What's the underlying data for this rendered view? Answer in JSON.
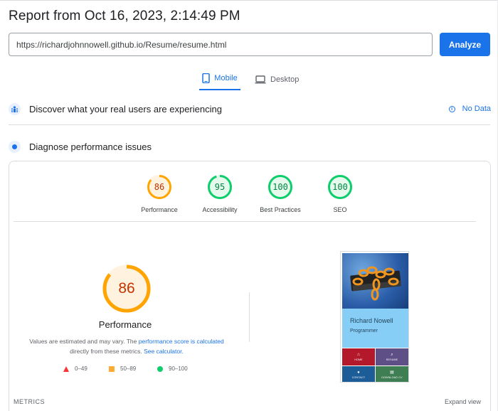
{
  "report": {
    "title": "Report from Oct 16, 2023, 2:14:49 PM"
  },
  "url_bar": {
    "value": "https://richardjohnnowell.github.io/Resume/resume.html",
    "analyze_label": "Analyze"
  },
  "device_tabs": {
    "mobile": "Mobile",
    "desktop": "Desktop",
    "active": "mobile"
  },
  "real_users": {
    "label": "Discover what your real users are experiencing",
    "no_data": "No Data"
  },
  "diagnose": {
    "label": "Diagnose performance issues"
  },
  "scores": [
    {
      "label": "Performance",
      "value": "86",
      "color": "#ffa400",
      "text_color": "#c33300",
      "fraction": 0.86
    },
    {
      "label": "Accessibility",
      "value": "95",
      "color": "#0cce6b",
      "text_color": "#018642",
      "fraction": 0.95
    },
    {
      "label": "Best Practices",
      "value": "100",
      "color": "#0cce6b",
      "text_color": "#018642",
      "fraction": 1.0
    },
    {
      "label": "SEO",
      "value": "100",
      "color": "#0cce6b",
      "text_color": "#018642",
      "fraction": 1.0
    }
  ],
  "performance": {
    "score": "86",
    "fraction": 0.86,
    "title": "Performance",
    "note_prefix": "Values are estimated and may vary. The ",
    "note_link": "performance score is calculated",
    "note_middle": " directly from these metrics. ",
    "note_link2": "See calculator."
  },
  "legend": {
    "low": "0–49",
    "mid": "50–89",
    "high": "90–100"
  },
  "screenshot": {
    "name": "Richard Nowell",
    "role": "Programmer",
    "tiles": {
      "home": "HOME",
      "resume": "RESUME",
      "contact": "CONTACT",
      "download": "DOWNLOAD CV"
    }
  },
  "footer": {
    "metrics": "METRICS",
    "expand": "Expand view"
  },
  "colors": {
    "accent": "#1a73e8",
    "pass": "#0cce6b",
    "average": "#ffa400",
    "fail": "#ff3333"
  }
}
